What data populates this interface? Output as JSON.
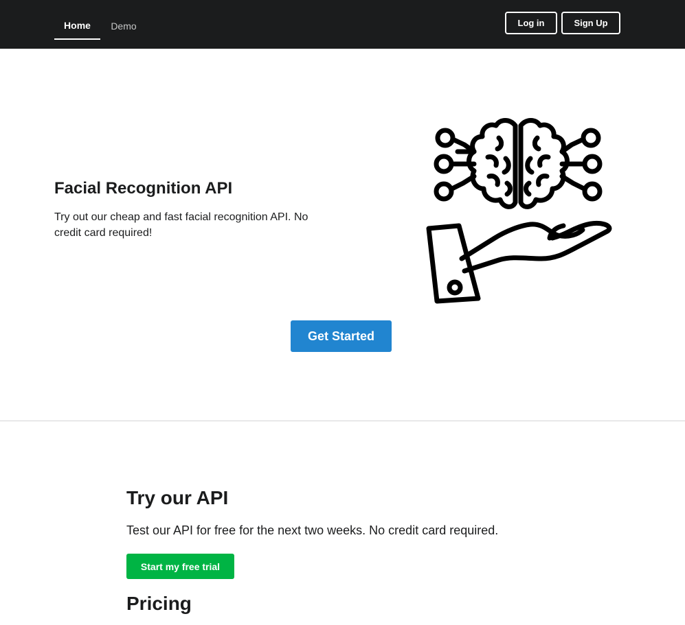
{
  "nav": {
    "home_label": "Home",
    "demo_label": "Demo",
    "login_label": "Log in",
    "signup_label": "Sign Up"
  },
  "hero": {
    "title": "Facial Recognition API",
    "description": "Try out our cheap and fast facial recognition API. No credit card required!",
    "cta_label": "Get Started",
    "illustration_icon": "brain-in-hand-icon"
  },
  "api_section": {
    "title": "Try our API",
    "description": "Test our API for free for the next two weeks. No credit card required.",
    "trial_label": "Start my free trial"
  },
  "pricing": {
    "title": "Pricing"
  },
  "colors": {
    "topbar_bg": "#1b1c1d",
    "primary_blue": "#2185d0",
    "trial_green": "#00b444"
  }
}
